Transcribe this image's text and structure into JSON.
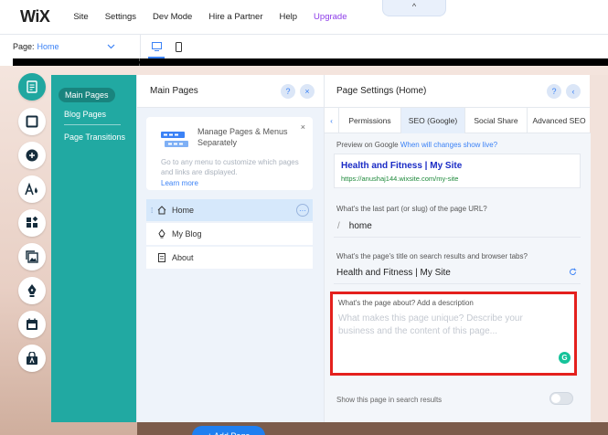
{
  "topbar": {
    "logo": "WiX",
    "menu": [
      "Site",
      "Settings",
      "Dev Mode",
      "Hire a Partner",
      "Help",
      "Upgrade"
    ],
    "collapse_glyph": "^"
  },
  "pagebar": {
    "page_label": "Page:",
    "page_value": "Home",
    "devices": [
      "desktop-icon",
      "mobile-icon"
    ]
  },
  "rail": {
    "icons": [
      "pages-icon",
      "background-icon",
      "add-icon",
      "theme-icon",
      "app-market-icon",
      "media-icon",
      "blog-icon",
      "bookings-icon",
      "store-icon"
    ]
  },
  "pages_nav": {
    "items": [
      "Main Pages",
      "Blog Pages",
      "Page Transitions"
    ]
  },
  "main_pages": {
    "title": "Main Pages",
    "help": "?",
    "close": "×",
    "promo": {
      "title": "Manage Pages & Menus Separately",
      "description": "Go to any menu to customize which pages and links are displayed.",
      "link": "Learn more",
      "close": "×"
    },
    "pages": [
      "Home",
      "My Blog",
      "About"
    ],
    "more_glyph": "···",
    "add_button": "+ Add Page"
  },
  "page_settings": {
    "title": "Page Settings (Home)",
    "help": "?",
    "back": "‹",
    "tabs": [
      "Permissions",
      "SEO (Google)",
      "Social Share",
      "Advanced SEO"
    ],
    "preview_label": "Preview on Google",
    "preview_link": "When will changes show live?",
    "preview_title": "Health and Fitness | My Site",
    "preview_url": "https://anushaj144.wixsite.com/my-site",
    "slug_label": "What's the last part (or slug) of the page URL?",
    "slug_value": "home",
    "title_label": "What's the page's title on search results and browser tabs?",
    "title_value": "Health and Fitness | My Site",
    "desc_label": "What's the page about? Add a description",
    "desc_placeholder": "What makes this page unique? Describe your business and the content of this page...",
    "show_label": "Show this page in search results",
    "show_toggle": false
  },
  "colors": {
    "teal": "#21a9a2",
    "accent": "#1f7ff0",
    "highlight": "#e4201d",
    "upgrade": "#8c3be8"
  }
}
